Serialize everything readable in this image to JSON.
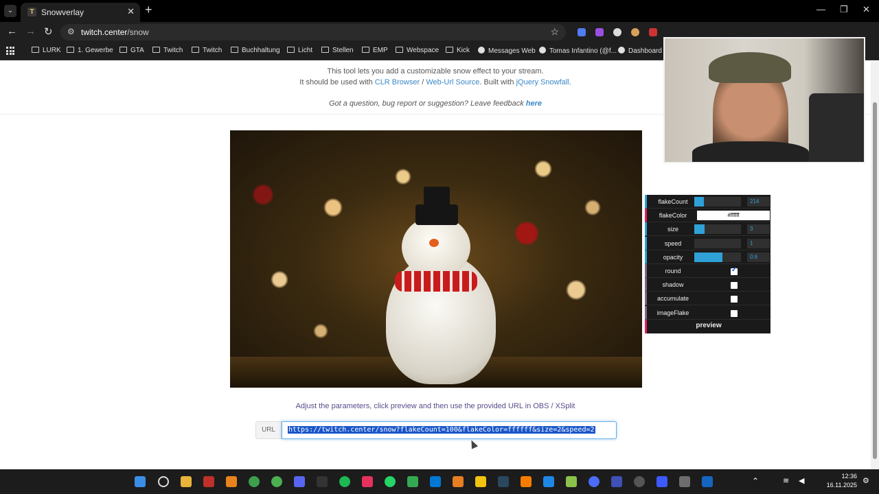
{
  "browser": {
    "tab_title": "Snowverlay",
    "tab_favicon": "T",
    "url_host": "twitch.center",
    "url_path": "/snow",
    "bookmarks": [
      "LURK",
      "1. Gewerbe",
      "GTA",
      "Twitch",
      "Twitch",
      "Buchhaltung",
      "Licht",
      "Stellen",
      "EMP",
      "Webspace",
      "Kick",
      "Messages Web",
      "Tomas Infantino (@f...",
      "Dashboard"
    ]
  },
  "page": {
    "intro_line1": "This tool lets you add a customizable snow effect to your stream.",
    "intro_line2_pre": "It should be used with",
    "link_clr": "CLR Browser",
    "slash": "/",
    "link_weburl": "Web-Url Source",
    "built_with": ". Built with",
    "link_jquery": "jQuery Snowfall",
    "period": ".",
    "feedback_text": "Got a question, bug report or suggestion? Leave feedback",
    "feedback_link": "here",
    "hint": "Adjust the parameters, click preview and then use the provided URL in OBS / XSplit",
    "url_label": "URL",
    "url_value": "https://twitch.center/snow?flakeCount=100&flakeColor=ffffff&size=2&speed=2"
  },
  "gui": {
    "flakeCount": {
      "label": "flakeCount",
      "value": "214",
      "fill": 0.2
    },
    "flakeColor": {
      "label": "flakeColor",
      "value": "#ffffff"
    },
    "size": {
      "label": "size",
      "value": "3",
      "fill": 0.22
    },
    "speed": {
      "label": "speed",
      "value": "1",
      "fill": 0
    },
    "opacity": {
      "label": "opacity",
      "value": "0.6",
      "fill": 0.6
    },
    "round": {
      "label": "round",
      "checked": true
    },
    "shadow": {
      "label": "shadow",
      "checked": false
    },
    "accumulate": {
      "label": "accumulate",
      "checked": false
    },
    "imageFlake": {
      "label": "imageFlake",
      "checked": false
    },
    "preview_label": "preview"
  },
  "taskbar": {
    "time": "12:36",
    "date": "16.11.2025"
  }
}
